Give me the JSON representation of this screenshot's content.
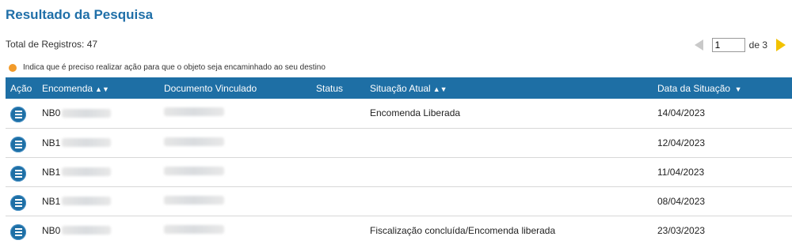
{
  "header": {
    "title": "Resultado da Pesquisa",
    "total": "Total de Registros: 47"
  },
  "pager": {
    "current_page": "1",
    "of_label": "de 3"
  },
  "legend": {
    "text": "Indica que é preciso realizar ação para que o objeto seja encaminhado ao seu destino",
    "dot_color": "#f29b2a"
  },
  "table": {
    "columns": {
      "acao": "Ação",
      "encomenda": "Encomenda",
      "documento": "Documento Vinculado",
      "status": "Status",
      "situacao": "Situação Atual",
      "data": "Data da Situação"
    },
    "header_color": "#1e6fa5",
    "rows": [
      {
        "encomenda": "NB0",
        "situacao": "Encomenda Liberada",
        "data": "14/04/2023"
      },
      {
        "encomenda": "NB1",
        "situacao": "",
        "data": "12/04/2023"
      },
      {
        "encomenda": "NB1",
        "situacao": "",
        "data": "11/04/2023"
      },
      {
        "encomenda": "NB1",
        "situacao": "",
        "data": "08/04/2023"
      },
      {
        "encomenda": "NB0",
        "situacao": "Fiscalização concluída/Encomenda liberada",
        "data": "23/03/2023"
      }
    ]
  }
}
